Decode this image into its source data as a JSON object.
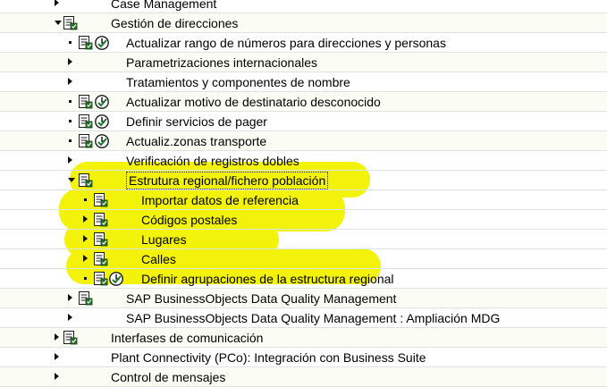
{
  "tree": {
    "rows": [
      {
        "label": "Case Management",
        "level": 0,
        "expander": "collapsed",
        "doc": false,
        "clock": false
      },
      {
        "label": "Gestión de direcciones",
        "level": 0,
        "expander": "expanded",
        "doc": true,
        "clock": false
      },
      {
        "label": "Actualizar rango de números para direcciones y personas",
        "level": 1,
        "expander": "leaf",
        "doc": true,
        "clock": true
      },
      {
        "label": "Parametrizaciones internacionales",
        "level": 1,
        "expander": "collapsed",
        "doc": false,
        "clock": false
      },
      {
        "label": "Tratamientos y componentes de nombre",
        "level": 1,
        "expander": "collapsed",
        "doc": false,
        "clock": false
      },
      {
        "label": "Actualizar motivo de destinatario desconocido",
        "level": 1,
        "expander": "leaf",
        "doc": true,
        "clock": true
      },
      {
        "label": "Definir servicios de pager",
        "level": 1,
        "expander": "leaf",
        "doc": true,
        "clock": true
      },
      {
        "label": "Actualiz.zonas transporte",
        "level": 1,
        "expander": "leaf",
        "doc": true,
        "clock": true
      },
      {
        "label": "Verificación de registros dobles",
        "level": 1,
        "expander": "collapsed",
        "doc": false,
        "clock": false
      },
      {
        "label": "Estrutura regional/fichero población",
        "level": 1,
        "expander": "expanded",
        "doc": true,
        "clock": false,
        "selected": true
      },
      {
        "label": "Importar datos de referencia",
        "level": 2,
        "expander": "leaf",
        "doc": true,
        "clock": false
      },
      {
        "label": "Códigos postales",
        "level": 2,
        "expander": "collapsed",
        "doc": true,
        "clock": false
      },
      {
        "label": "Lugares",
        "level": 2,
        "expander": "collapsed",
        "doc": true,
        "clock": false
      },
      {
        "label": "Calles",
        "level": 2,
        "expander": "collapsed",
        "doc": true,
        "clock": false
      },
      {
        "label": "Definir agrupaciones de la estructura regional",
        "level": 2,
        "expander": "leaf",
        "doc": true,
        "clock": true
      },
      {
        "label": "SAP BusinessObjects Data Quality Management",
        "level": 1,
        "expander": "collapsed",
        "doc": true,
        "clock": false
      },
      {
        "label": "SAP BusinessObjects Data Quality Management : Ampliación MDG",
        "level": 1,
        "expander": "collapsed",
        "doc": false,
        "clock": false
      },
      {
        "label": "Interfases de comunicación",
        "level": 0,
        "expander": "collapsed",
        "doc": true,
        "clock": false
      },
      {
        "label": "Plant Connectivity (PCo): Integración con Business Suite",
        "level": 0,
        "expander": "collapsed",
        "doc": false,
        "clock": false
      },
      {
        "label": "Control de mensajes",
        "level": 0,
        "expander": "collapsed",
        "doc": false,
        "clock": false
      }
    ]
  },
  "icons": {
    "collapsed": "triangle-right-icon",
    "expanded": "triangle-down-icon",
    "leaf": "bullet-dot-icon",
    "doc": "documentation-icon",
    "clock": "execute-activity-clock-icon"
  },
  "colors": {
    "highlight": "#f2f20a",
    "doc_icon": "#2a6e2a",
    "clock_icon": "#1e7a2e",
    "row_border": "#d9e5e3"
  }
}
